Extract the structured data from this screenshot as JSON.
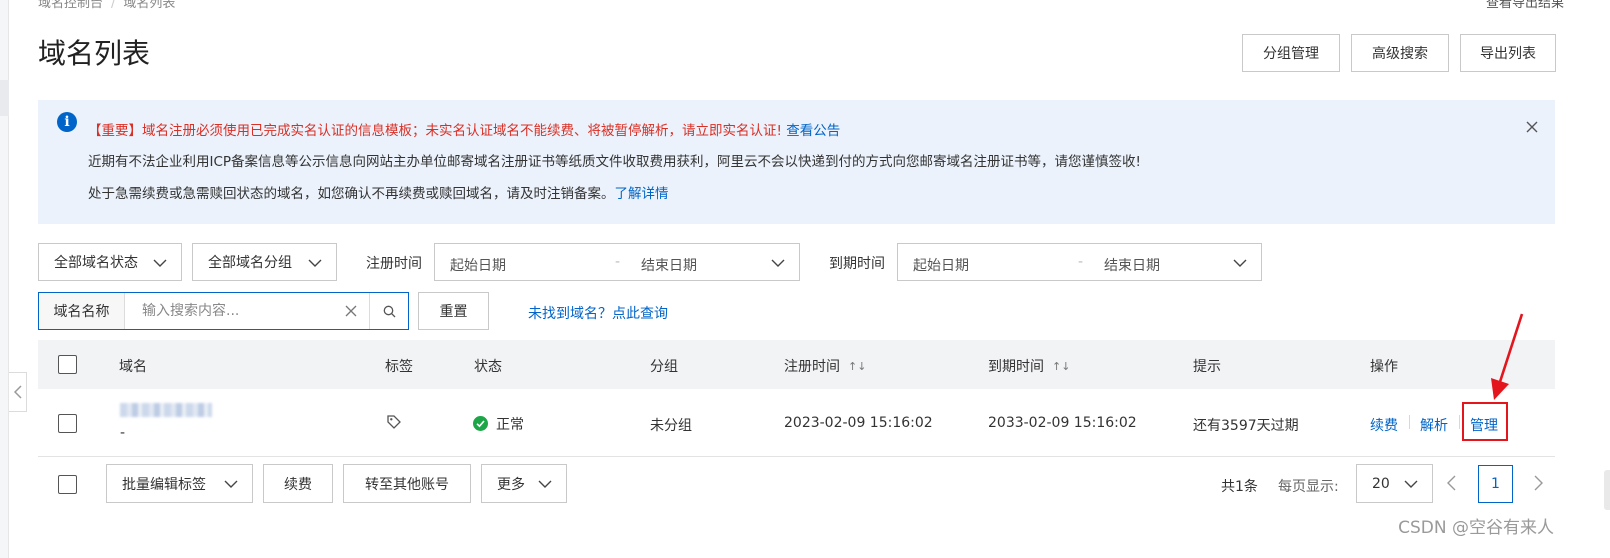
{
  "breadcrumb": {
    "parent": "域名控制台",
    "current": "域名列表"
  },
  "top_right_link": "查看导出结果",
  "page_title": "域名列表",
  "header_buttons": {
    "group_manage": "分组管理",
    "advanced_search": "高级搜索",
    "export_list": "导出列表"
  },
  "notice": {
    "line1_text": "【重要】域名注册必须使用已完成实名认证的信息模板；未实名认证域名不能续费、将被暂停解析，请立即实名认证!",
    "line1_link": "查看公告",
    "line2_text": "近期有不法企业利用ICP备案信息等公示信息向网站主办单位邮寄域名注册证书等纸质文件收取费用获利，阿里云不会以快递到付的方式向您邮寄域名注册证书等，请您谨慎签收!",
    "line3_text": "处于急需续费或急需赎回状态的域名，如您确认不再续费或赎回域名，请及时注销备案。",
    "line3_link": "了解详情"
  },
  "filters": {
    "status_select": "全部域名状态",
    "group_select": "全部域名分组",
    "reg_time_label": "注册时间",
    "exp_time_label": "到期时间",
    "start_date_placeholder": "起始日期",
    "end_date_placeholder": "结束日期",
    "date_dash": "-"
  },
  "search": {
    "field_label": "域名名称",
    "placeholder": "输入搜索内容...",
    "reset_label": "重置",
    "not_found_link": "未找到域名？点此查询"
  },
  "table": {
    "columns": {
      "domain": "域名",
      "tag": "标签",
      "status": "状态",
      "group": "分组",
      "reg_time": "注册时间",
      "exp_time": "到期时间",
      "hint": "提示",
      "actions": "操作"
    },
    "rows": [
      {
        "domain_sub": "-",
        "status": "正常",
        "group": "未分组",
        "reg_time": "2023-02-09 15:16:02",
        "exp_time": "2033-02-09 15:16:02",
        "hint": "还有3597天过期",
        "actions": {
          "renew": "续费",
          "resolve": "解析",
          "manage": "管理"
        }
      }
    ]
  },
  "footer": {
    "batch_edit_tags": "批量编辑标签",
    "renew": "续费",
    "transfer": "转至其他账号",
    "more": "更多",
    "total": "共1条",
    "per_page_label": "每页显示:",
    "per_page_value": "20",
    "current_page": "1"
  },
  "watermark": "CSDN @空谷有来人",
  "colors": {
    "primary": "#0064c8",
    "warning": "#d93026",
    "success": "#1ca648",
    "annotation": "#e3161d"
  }
}
